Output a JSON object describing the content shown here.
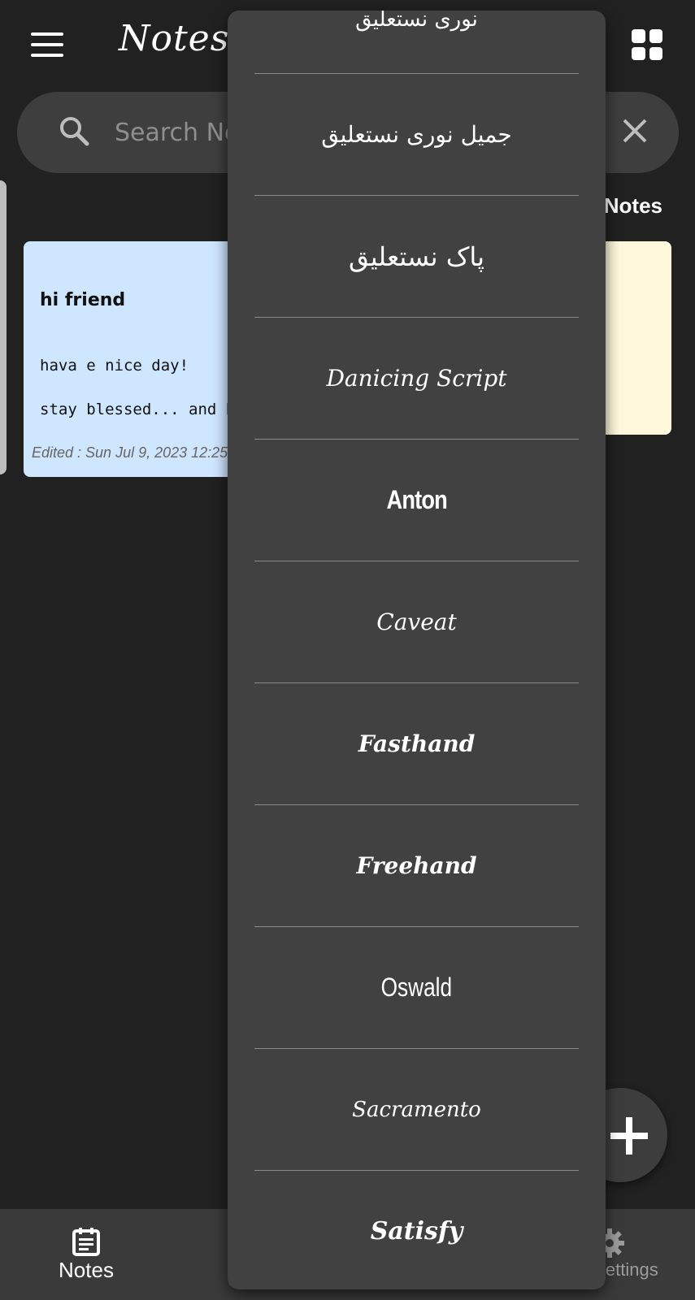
{
  "app": {
    "title": "Notes Pro"
  },
  "search": {
    "placeholder": "Search Notes"
  },
  "section": {
    "title": "Notes"
  },
  "notes": [
    {
      "title": "hi friend",
      "lines": [
        "hava e nice day!",
        "stay blessed... and happ"
      ],
      "edited": "Edited : Sun Jul 9, 2023 12:25",
      "color": "#cfe6ff"
    },
    {
      "color": "#fff8dc"
    }
  ],
  "font_menu": {
    "items": [
      "نوری نستعلیق",
      "جمیل نوری نستعلیق",
      "پاک نستعلیق",
      "Danicing Script",
      "Anton",
      "Caveat",
      "Fasthand",
      "Freehand",
      "Oswald",
      "Sacramento",
      "Satisfy"
    ]
  },
  "bottom_nav": {
    "notes_label": "Notes",
    "settings_label": "Settings"
  },
  "colors": {
    "background": "#212121",
    "surface": "#3e3e3e",
    "menu": "#414141",
    "note_blue": "#cfe6ff",
    "note_yellow": "#fff8dc"
  }
}
